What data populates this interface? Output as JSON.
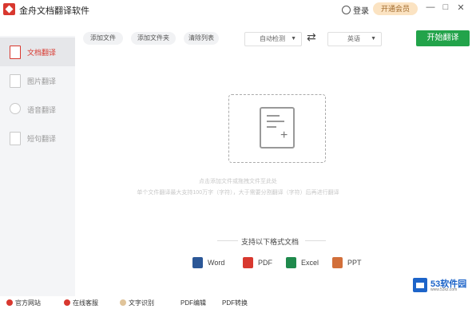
{
  "app": {
    "title": "金舟文档翻译软件",
    "login": "登录",
    "vip": "开通会员"
  },
  "window_controls": {
    "minimize": "—",
    "maximize": "□",
    "close": "✕"
  },
  "sidebar": {
    "items": [
      {
        "label": "文档翻译",
        "icon": "document-icon",
        "active": true
      },
      {
        "label": "图片翻译",
        "icon": "image-icon",
        "active": false
      },
      {
        "label": "语音翻译",
        "icon": "voice-icon",
        "active": false
      },
      {
        "label": "短句翻译",
        "icon": "text-icon",
        "active": false
      }
    ]
  },
  "toolbar": {
    "add_file": "添加文件",
    "add_folder": "添加文件夹",
    "clear_list": "清除列表",
    "source_lang": "自动检测",
    "target_lang": "英语",
    "start": "开始翻译"
  },
  "dropzone": {
    "hint1": "点击添加文件或拖拽文件至此处",
    "hint2": "单个文件翻译最大支持100万字（字符），大于需要分割翻译（字符）后再进行翻译"
  },
  "support": {
    "title": "支持以下格式文档",
    "formats": [
      {
        "label": "Word",
        "color": "#2b5797"
      },
      {
        "label": "PDF",
        "color": "#d8382f"
      },
      {
        "label": "Excel",
        "color": "#1f8a4c"
      },
      {
        "label": "PPT",
        "color": "#d26f3a"
      }
    ]
  },
  "footer": {
    "website": "官方网站",
    "service": "在线客服",
    "ocr": "文字识别",
    "pdf_edit": "PDF编辑",
    "pdf_convert": "PDF转换"
  },
  "watermark": {
    "brand": "53软件园",
    "url": "www.53xz.com"
  },
  "colors": {
    "accent": "#d8382f",
    "start_button": "#22a34a"
  }
}
